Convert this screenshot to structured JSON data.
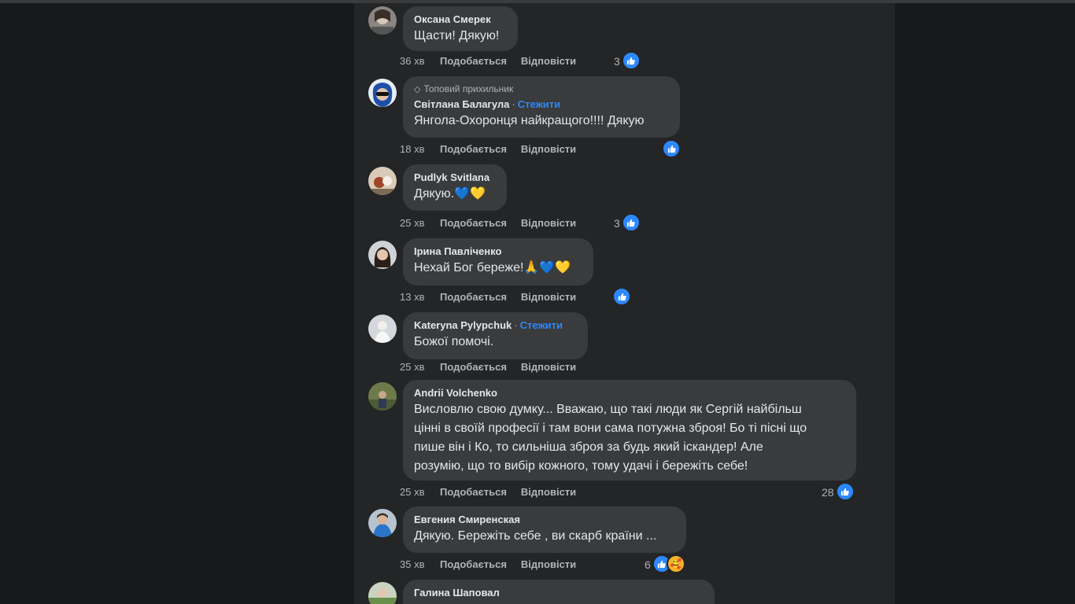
{
  "labels": {
    "like": "Подобається",
    "reply": "Відповісти",
    "follow": "Стежити",
    "top_fan": "Топовий прихильник"
  },
  "colors": {
    "background": "#18191a",
    "panel": "#242526",
    "bubble": "#3a3b3c",
    "accent": "#2d88ff"
  },
  "comments": [
    {
      "author": "Оксана Смерек",
      "text": [
        "Щасти! Дякую!"
      ],
      "time": "36 хв",
      "reactions": "3"
    },
    {
      "author": "Світлана Балагула",
      "text": [
        "Янгола-Охоронця найкращого!!!! Дякую"
      ],
      "time": "18 хв",
      "reactions": ""
    },
    {
      "author": "Pudlyk Svitlana",
      "text": [
        "Дякую.💙💛"
      ],
      "time": "25 хв",
      "reactions": "3"
    },
    {
      "author": "Ірина Павліченко",
      "text": [
        "Нехай Бог береже!🙏💙💛"
      ],
      "time": "13 хв",
      "reactions": ""
    },
    {
      "author": "Kateryna Pylypchuk",
      "text": [
        "Божої помочі."
      ],
      "time": "25 хв"
    },
    {
      "author": "Andrii Volchenko",
      "text": [
        "Висловлю свою думку... Вважаю, що такі люди як Сергій найбільш",
        "цінні в своїй професії і там вони сама потужна зброя! Бо ті пісні що",
        "пише він і Ко, то сильніша зброя за будь який іскандер! Але",
        "розумію, що то вибір кожного, тому удачі і бережіть себе!"
      ],
      "time": "25 хв",
      "reactions": "28"
    },
    {
      "author": "Евгения Смиренская",
      "text": [
        "Дякую. Бережіть себе , ви скарб країни ..."
      ],
      "time": "35 хв",
      "reactions": "6"
    },
    {
      "author": "Галина Шаповал"
    }
  ]
}
